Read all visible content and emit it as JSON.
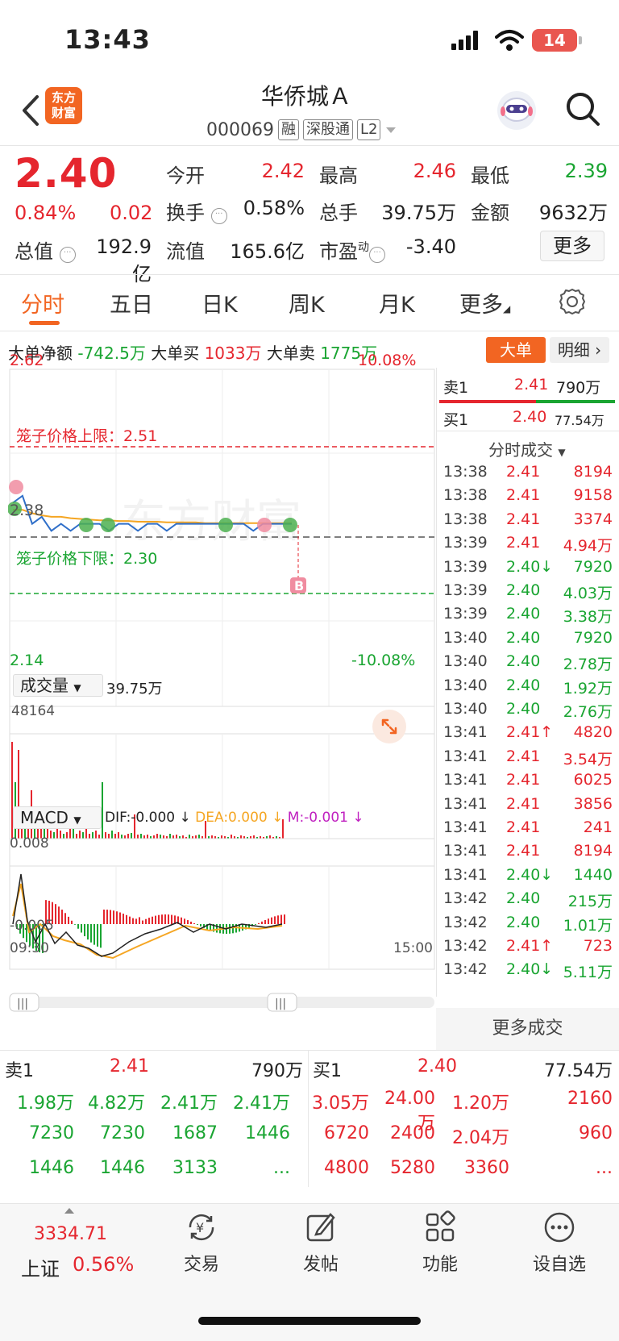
{
  "status_bar": {
    "time": "13:43",
    "battery": "14"
  },
  "header": {
    "logo_text_1": "东方",
    "logo_text_2": "财富",
    "stock_name": "华侨城Ａ",
    "stock_code": "000069",
    "tags": [
      "融",
      "深股通",
      "L2"
    ]
  },
  "quote": {
    "price": "2.40",
    "change_pct": "0.84%",
    "change_amt": "0.02",
    "open_label": "今开",
    "open": "2.42",
    "high_label": "最高",
    "high": "2.46",
    "low_label": "最低",
    "low": "2.39",
    "turnover_label": "换手",
    "turnover": "0.58%",
    "volume_label": "总手",
    "volume": "39.75万",
    "amount_label": "金额",
    "amount": "9632万",
    "mktcap_label": "总值",
    "mktcap": "192.9亿",
    "float_label": "流值",
    "float": "165.6亿",
    "pe_label": "市盈",
    "pe_sup": "动",
    "pe": "-3.40",
    "more_label": "更多"
  },
  "tabs": [
    "分时",
    "五日",
    "日K",
    "周K",
    "月K",
    "更多"
  ],
  "big_order": {
    "net_label": "大单净额",
    "net": "-742.5万",
    "buy_label": "大单买",
    "buy": "1033万",
    "sell_label": "大单卖",
    "sell": "1775万",
    "button_big": "大单",
    "button_detail": "明细"
  },
  "chart": {
    "y_top": "2.62",
    "y_top_pct": "10.08%",
    "y_bottom": "2.14",
    "y_bottom_pct": "-10.08%",
    "ref_price": "2.38",
    "upper_limit_label": "笼子价格上限：2.51",
    "lower_limit_label": "笼子价格下限：2.30",
    "b_marker": "B",
    "watermark": "东方财富",
    "volume_selector": "成交量",
    "volume_total": "39.75万",
    "volume_max": "48164",
    "macd_selector": "MACD",
    "dif": "DIF:-0.000 ↓",
    "dea": "DEA:0.000 ↓",
    "m": "M:-0.001 ↓",
    "macd_top": "0.008",
    "macd_bottom": "-0.005",
    "time_start": "09:30",
    "time_end": "15:00",
    "colors": {
      "up": "#e5262e",
      "down": "#1aa532",
      "price_line": "#2f6fc9",
      "avg_line": "#f5a623"
    }
  },
  "chart_data": {
    "type": "line",
    "title": "",
    "xlabel": "",
    "ylabel": "",
    "ylim": [
      2.14,
      2.62
    ],
    "series": [
      {
        "values": [
          2.43,
          2.44,
          2.4,
          2.41,
          2.39,
          2.4,
          2.39,
          2.4,
          2.4,
          2.4,
          2.39,
          2.4,
          2.4,
          2.39,
          2.4,
          2.4,
          2.39,
          2.4,
          2.4,
          2.4,
          2.4,
          2.4,
          2.4,
          2.4,
          2.4,
          2.39,
          2.4,
          2.4,
          2.4,
          2.4
        ]
      },
      {
        "values": [
          2.42,
          2.42,
          2.415,
          2.412,
          2.41,
          2.41,
          2.408,
          2.407,
          2.406,
          2.405,
          2.405,
          2.404,
          2.404,
          2.403,
          2.403,
          2.403,
          2.402,
          2.402,
          2.402,
          2.402,
          2.401,
          2.401,
          2.401,
          2.401,
          2.401,
          2.401,
          2.401,
          2.401,
          2.401,
          2.401
        ]
      }
    ]
  },
  "side_panel": {
    "sell1": {
      "label": "卖1",
      "price": "2.41",
      "vol": "790万"
    },
    "buy1": {
      "label": "买1",
      "price": "2.40",
      "vol": "77.54万"
    },
    "ticks_header": "分时成交",
    "ticks": [
      {
        "t": "13:38",
        "p": "2.41",
        "v": "8194",
        "c": "red",
        "a": ""
      },
      {
        "t": "13:38",
        "p": "2.41",
        "v": "9158",
        "c": "red",
        "a": ""
      },
      {
        "t": "13:38",
        "p": "2.41",
        "v": "3374",
        "c": "red",
        "a": ""
      },
      {
        "t": "13:39",
        "p": "2.41",
        "v": "4.94万",
        "c": "red",
        "a": ""
      },
      {
        "t": "13:39",
        "p": "2.40",
        "v": "7920",
        "c": "green",
        "a": "↓"
      },
      {
        "t": "13:39",
        "p": "2.40",
        "v": "4.03万",
        "c": "green",
        "a": ""
      },
      {
        "t": "13:39",
        "p": "2.40",
        "v": "3.38万",
        "c": "green",
        "a": ""
      },
      {
        "t": "13:40",
        "p": "2.40",
        "v": "7920",
        "c": "green",
        "a": ""
      },
      {
        "t": "13:40",
        "p": "2.40",
        "v": "2.78万",
        "c": "green",
        "a": ""
      },
      {
        "t": "13:40",
        "p": "2.40",
        "v": "1.92万",
        "c": "green",
        "a": ""
      },
      {
        "t": "13:40",
        "p": "2.40",
        "v": "2.76万",
        "c": "green",
        "a": ""
      },
      {
        "t": "13:41",
        "p": "2.41",
        "v": "4820",
        "c": "red",
        "a": "↑"
      },
      {
        "t": "13:41",
        "p": "2.41",
        "v": "3.54万",
        "c": "red",
        "a": ""
      },
      {
        "t": "13:41",
        "p": "2.41",
        "v": "6025",
        "c": "red",
        "a": ""
      },
      {
        "t": "13:41",
        "p": "2.41",
        "v": "3856",
        "c": "red",
        "a": ""
      },
      {
        "t": "13:41",
        "p": "2.41",
        "v": "241",
        "c": "red",
        "a": ""
      },
      {
        "t": "13:41",
        "p": "2.41",
        "v": "8194",
        "c": "red",
        "a": ""
      },
      {
        "t": "13:41",
        "p": "2.40",
        "v": "1440",
        "c": "green",
        "a": "↓"
      },
      {
        "t": "13:42",
        "p": "2.40",
        "v": "215万",
        "c": "green",
        "a": ""
      },
      {
        "t": "13:42",
        "p": "2.40",
        "v": "1.01万",
        "c": "green",
        "a": ""
      },
      {
        "t": "13:42",
        "p": "2.41",
        "v": "723",
        "c": "red",
        "a": "↑"
      },
      {
        "t": "13:42",
        "p": "2.40",
        "v": "5.11万",
        "c": "green",
        "a": "↓"
      }
    ],
    "more_ticks": "更多成交"
  },
  "order_book": {
    "sell": {
      "label": "卖1",
      "price": "2.41",
      "vol": "790万",
      "rows": [
        [
          "1.98万",
          "4.82万",
          "2.41万",
          "2.41万"
        ],
        [
          "7230",
          "7230",
          "1687",
          "1446"
        ],
        [
          "1446",
          "1446",
          "3133",
          "..."
        ]
      ]
    },
    "buy": {
      "label": "买1",
      "price": "2.40",
      "vol": "77.54万",
      "rows": [
        [
          "3.05万",
          "24.00万",
          "1.20万",
          "2160"
        ],
        [
          "6720",
          "2400",
          "2.04万",
          "960"
        ],
        [
          "4800",
          "5280",
          "3360",
          "..."
        ]
      ]
    }
  },
  "bottom_nav": {
    "index_value": "3334.71",
    "index_name": "上证",
    "index_pct": "0.56%",
    "items": [
      "交易",
      "发帖",
      "功能",
      "设自选"
    ]
  }
}
